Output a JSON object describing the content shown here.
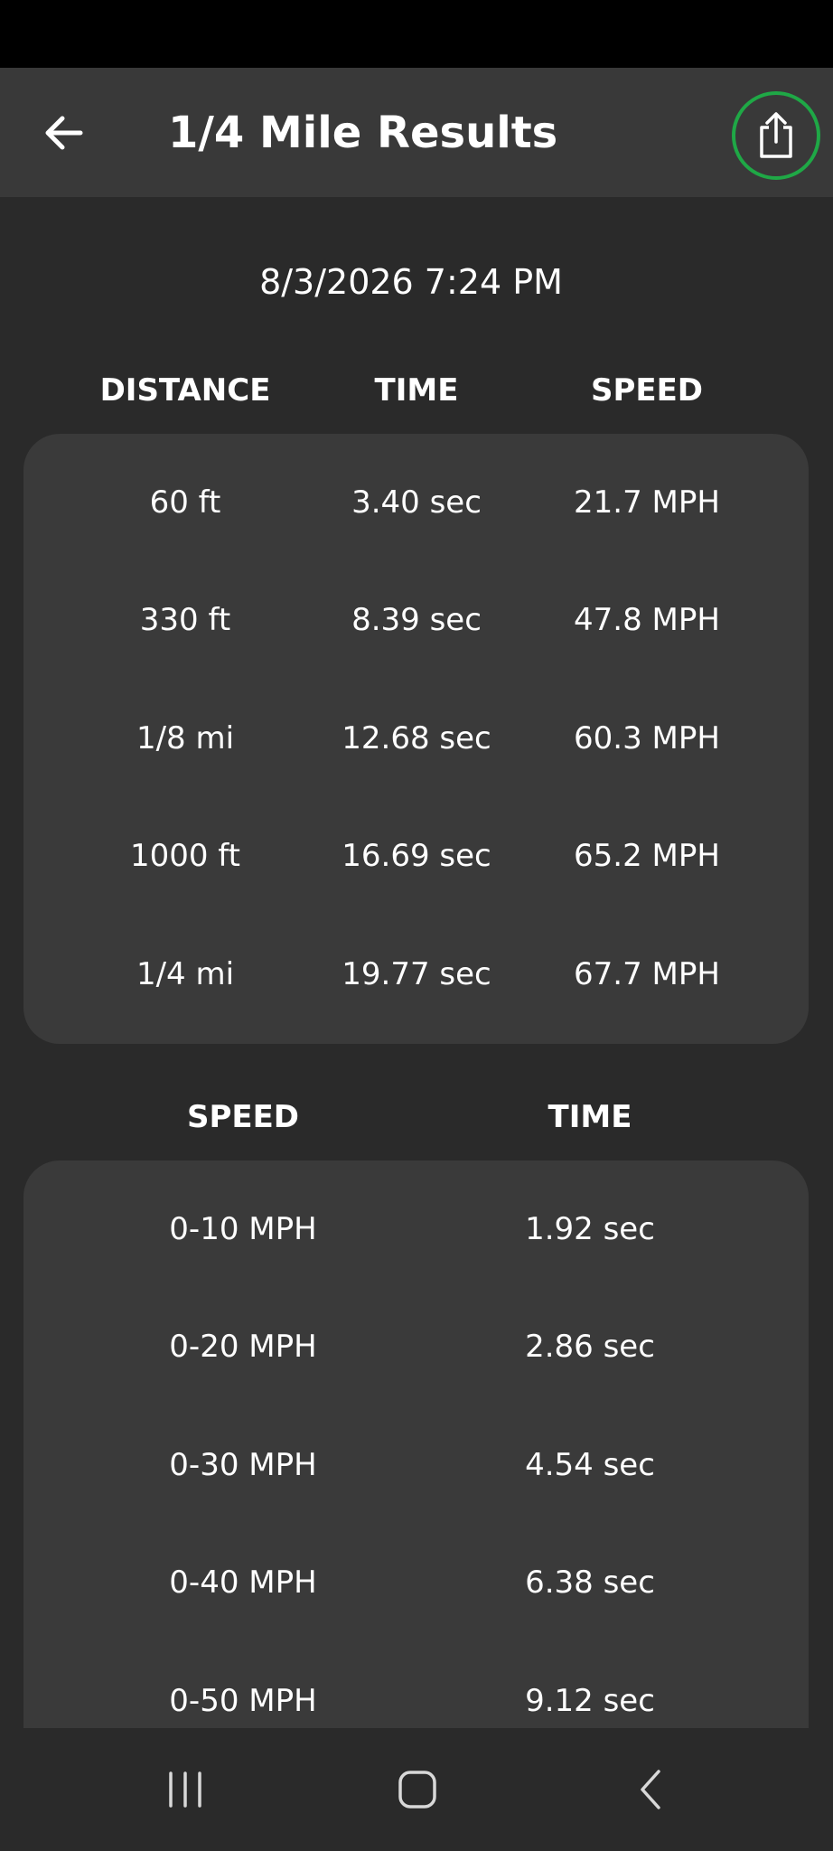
{
  "app_bar": {
    "title": "1/4 Mile Results",
    "back_icon": "arrow-left-icon",
    "share_icon": "share-icon",
    "share_accent_color": "#1fa846"
  },
  "timestamp": "8/3/2026 7:24 PM",
  "distance_table": {
    "headers": [
      "DISTANCE",
      "TIME",
      "SPEED"
    ],
    "rows": [
      [
        "60 ft",
        "3.40 sec",
        "21.7 MPH"
      ],
      [
        "330 ft",
        "8.39 sec",
        "47.8 MPH"
      ],
      [
        "1/8 mi",
        "12.68 sec",
        "60.3 MPH"
      ],
      [
        "1000 ft",
        "16.69 sec",
        "65.2 MPH"
      ],
      [
        "1/4 mi",
        "19.77 sec",
        "67.7 MPH"
      ]
    ]
  },
  "speed_table": {
    "headers": [
      "SPEED",
      "TIME"
    ],
    "rows": [
      [
        "0-10 MPH",
        "1.92 sec"
      ],
      [
        "0-20 MPH",
        "2.86 sec"
      ],
      [
        "0-30 MPH",
        "4.54 sec"
      ],
      [
        "0-40 MPH",
        "6.38 sec"
      ],
      [
        "0-50 MPH",
        "9.12 sec"
      ]
    ]
  },
  "nav_bar": {
    "recents_icon": "recents-icon",
    "home_icon": "home-icon",
    "back_icon": "nav-back-icon"
  }
}
